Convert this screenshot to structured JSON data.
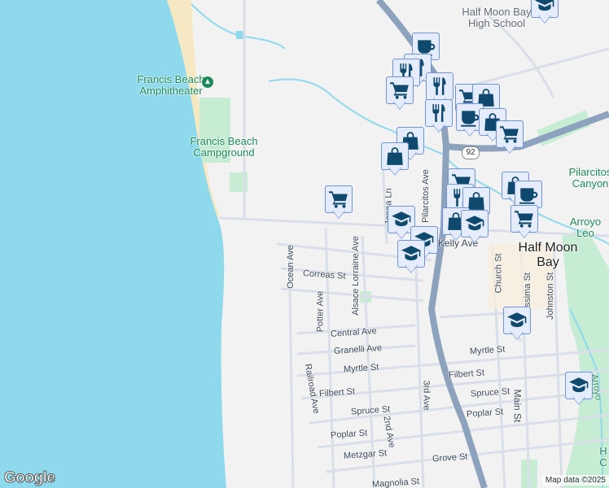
{
  "places": {
    "school": "Half Moon Bay High School",
    "amphitheater": "Francis Beach Amphitheater",
    "campground": "Francis Beach Campground",
    "canyon": "Pilarcitos Canyon",
    "arroyo": "Arroyo Leo",
    "town": "Half Moon Bay",
    "creek_right": "Arroyo",
    "right_edge": "H C"
  },
  "streets": {
    "kelly": "Kelly Ave",
    "ocean": "Ocean Ave",
    "correas": "Correas St",
    "alsace": "Alsace Lorraine Ave",
    "potter": "Potter Ave",
    "central": "Central Ave",
    "granelli": "Granelli Ave",
    "myrtle_w": "Myrtle St",
    "myrtle_e": "Myrtle St",
    "filbert_w": "Filbert St",
    "filbert_e": "Filbert St",
    "spruce_w": "Spruce St",
    "spruce_e": "Spruce St",
    "poplar_w": "Poplar St",
    "poplar_e": "Poplar St",
    "metzgar": "Metzgar St",
    "grove": "Grove St",
    "magnolia": "Magnolia St",
    "railroad": "Railroad Ave",
    "second": "2nd Ave",
    "third": "3rd Ave",
    "main": "Main St",
    "church": "Church St",
    "purissima": "Purissima St",
    "johnston": "Johnston St",
    "jenna": "Jenna Ln",
    "pilarcitos_ave": "Pilarcitos Ave",
    "route": "92"
  },
  "colors": {
    "water": "#8ed9ec",
    "land": "#f3f2f2",
    "beach": "#f5e8c2",
    "park": "#c6ecd4",
    "highway": "#8da3bd",
    "road": "#d8dfe8",
    "marker_bg": "#e4ecfd",
    "marker_icon": "#0f4a6e"
  },
  "footer": {
    "logo": "Google",
    "attribution": "Map data ©2025"
  }
}
